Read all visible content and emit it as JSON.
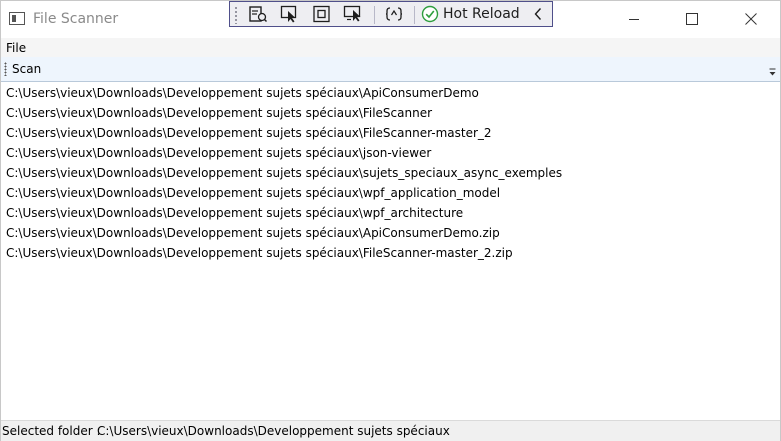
{
  "window": {
    "title": "File Scanner"
  },
  "devtools": {
    "hot_reload_label": "Hot Reload",
    "icons": [
      "go-to-live-visual-tree-icon",
      "select-element-icon",
      "display-layout-adorners-icon",
      "track-focused-element-icon",
      "binding-failures-icon",
      "hot-reload-check-icon",
      "collapse-chevron-icon"
    ]
  },
  "menu": {
    "file_label": "File"
  },
  "toolbar": {
    "scan_label": "Scan"
  },
  "folders": [
    "C:\\Users\\vieux\\Downloads\\Developpement sujets spéciaux\\ApiConsumerDemo",
    "C:\\Users\\vieux\\Downloads\\Developpement sujets spéciaux\\FileScanner",
    "C:\\Users\\vieux\\Downloads\\Developpement sujets spéciaux\\FileScanner-master_2",
    "C:\\Users\\vieux\\Downloads\\Developpement sujets spéciaux\\json-viewer",
    "C:\\Users\\vieux\\Downloads\\Developpement sujets spéciaux\\sujets_speciaux_async_exemples",
    "C:\\Users\\vieux\\Downloads\\Developpement sujets spéciaux\\wpf_application_model",
    "C:\\Users\\vieux\\Downloads\\Developpement sujets spéciaux\\wpf_architecture",
    "C:\\Users\\vieux\\Downloads\\Developpement sujets spéciaux\\ApiConsumerDemo.zip",
    "C:\\Users\\vieux\\Downloads\\Developpement sujets spéciaux\\FileScanner-master_2.zip"
  ],
  "status": {
    "label": "Selected folder :",
    "value": "C:\\Users\\vieux\\Downloads\\Developpement sujets spéciaux"
  },
  "colors": {
    "devbar_border": "#4f4f8a",
    "toolbar_bg": "#eef5fd",
    "hot_reload_green": "#2e9e3e"
  }
}
